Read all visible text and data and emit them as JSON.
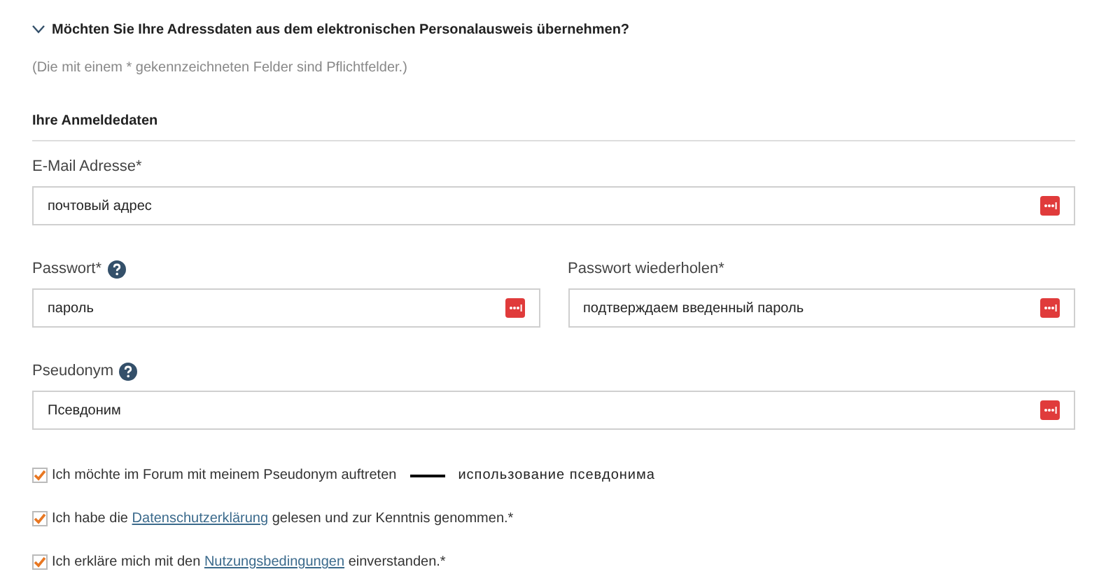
{
  "accordion": {
    "title": "Möchten Sie Ihre Adressdaten aus dem elektronischen Personalausweis übernehmen?",
    "expanded": false
  },
  "note": "(Die mit einem * gekennzeichneten Felder sind Pflichtfelder.)",
  "section_title": "Ihre Anmeldedaten",
  "field_rows": [
    {
      "fields": [
        {
          "label": "E-Mail Adresse*",
          "help": false,
          "value": "почтовый адрес"
        }
      ]
    },
    {
      "fields": [
        {
          "label": "Passwort*",
          "help": true,
          "value": "пароль"
        },
        {
          "label": "Passwort wiederholen*",
          "help": false,
          "value": "подтверждаем введенный пароль"
        }
      ]
    },
    {
      "fields": [
        {
          "label": "Pseudonym",
          "help": true,
          "value": "Псевдоним"
        }
      ]
    }
  ],
  "checkboxes": [
    {
      "checked": true,
      "before": "Ich möchte im Forum mit meinem Pseudonym auftreten",
      "annotation": "использование псевдонима"
    },
    {
      "checked": true,
      "before": "Ich habe die",
      "link": "Datenschutzerklärung",
      "after": "gelesen und zur Kenntnis genommen.*"
    },
    {
      "checked": true,
      "before": "Ich erkläre mich mit den",
      "link": "Nutzungsbedingungen",
      "after": "einverstanden.*"
    }
  ]
}
